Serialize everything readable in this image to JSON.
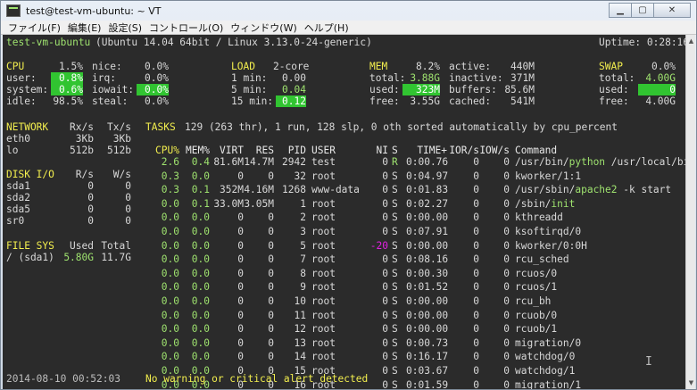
{
  "window": {
    "title": "test@test-vm-ubuntu: ~ VT"
  },
  "menu": [
    "ファイル(F)",
    "編集(E)",
    "設定(S)",
    "コントロール(O)",
    "ウィンドウ(W)",
    "ヘルプ(H)"
  ],
  "top": {
    "host": "test-vm-ubuntu",
    "os": "(Ubuntu 14.04 64bit / Linux 3.13.0-24-generic)",
    "uptime": "Uptime: 0:28:16"
  },
  "cpu": {
    "title": "CPU",
    "total": "1.5%",
    "user_l": "user:",
    "user": "0.8%",
    "system_l": "system:",
    "system": "0.6%",
    "idle_l": "idle:",
    "idle": "98.5%",
    "nice_l": "nice:",
    "nice": "0.0%",
    "irq_l": "irq:",
    "irq": "0.0%",
    "iowait_l": "iowait:",
    "iowait": "0.0%",
    "steal_l": "steal:",
    "steal": "0.0%"
  },
  "load": {
    "title": "LOAD",
    "cores": "2-core",
    "m1_l": "1 min:",
    "m1": "0.00",
    "m5_l": "5 min:",
    "m5": "0.04",
    "m15_l": "15 min:",
    "m15": "0.12"
  },
  "mem": {
    "title": "MEM",
    "pct": "8.2%",
    "total_l": "total:",
    "total": "3.88G",
    "used_l": "used:",
    "used": "323M",
    "free_l": "free:",
    "free": "3.55G",
    "active_l": "active:",
    "active": "440M",
    "inactive_l": "inactive:",
    "inactive": "371M",
    "buffers_l": "buffers:",
    "buffers": "85.6M",
    "cached_l": "cached:",
    "cached": "541M"
  },
  "swap": {
    "title": "SWAP",
    "pct": "0.0%",
    "total_l": "total:",
    "total": "4.00G",
    "used_l": "used:",
    "used": "0",
    "free_l": "free:",
    "free": "4.00G"
  },
  "network": {
    "title": "NETWORK",
    "rx": "Rx/s",
    "tx": "Tx/s",
    "rows": [
      [
        "eth0",
        "3Kb",
        "3Kb"
      ],
      [
        "lo",
        "512b",
        "512b"
      ]
    ]
  },
  "disk": {
    "title": "DISK I/O",
    "r": "R/s",
    "w": "W/s",
    "rows": [
      [
        "sda1",
        "0",
        "0"
      ],
      [
        "sda2",
        "0",
        "0"
      ],
      [
        "sda5",
        "0",
        "0"
      ],
      [
        "sr0",
        "0",
        "0"
      ]
    ]
  },
  "fs": {
    "title": "FILE SYS",
    "used": "Used",
    "total": "Total",
    "rows": [
      [
        "/ (sda1)",
        "5.80G",
        "11.7G"
      ]
    ]
  },
  "tasks": {
    "title": "TASKS",
    "summary": "129 (263 thr), 1 run, 128 slp, 0 oth sorted automatically by cpu_percent"
  },
  "columns": {
    "cpu": "CPU%",
    "mem": "MEM%",
    "virt": "VIRT",
    "res": "RES",
    "pid": "PID",
    "user": "USER",
    "ni": "NI",
    "s": "S",
    "time": "TIME+",
    "ior": "IOR/s",
    "iow": "IOW/s",
    "cmd": "Command"
  },
  "procs": [
    {
      "cpu": "2.6",
      "mem": "0.4",
      "virt": "81.6M",
      "res": "14.7M",
      "pid": "2942",
      "user": "test",
      "ni": "0",
      "s": "R",
      "time": "0:00.76",
      "ior": "0",
      "iow": "0",
      "cmd_a": "/usr/bin/",
      "cmd_b": "python",
      "cmd_c": " /usr/local/bin/"
    },
    {
      "cpu": "0.3",
      "mem": "0.0",
      "virt": "0",
      "res": "0",
      "pid": "32",
      "user": "root",
      "ni": "0",
      "s": "S",
      "time": "0:04.97",
      "ior": "0",
      "iow": "0",
      "cmd_a": "kworker/1:1",
      "cmd_b": "",
      "cmd_c": ""
    },
    {
      "cpu": "0.3",
      "mem": "0.1",
      "virt": "352M",
      "res": "4.16M",
      "pid": "1268",
      "user": "www-data",
      "ni": "0",
      "s": "S",
      "time": "0:01.83",
      "ior": "0",
      "iow": "0",
      "cmd_a": "/usr/sbin/",
      "cmd_b": "apache2",
      "cmd_c": " -k start"
    },
    {
      "cpu": "0.0",
      "mem": "0.1",
      "virt": "33.0M",
      "res": "3.05M",
      "pid": "1",
      "user": "root",
      "ni": "0",
      "s": "S",
      "time": "0:02.27",
      "ior": "0",
      "iow": "0",
      "cmd_a": "/sbin/",
      "cmd_b": "init",
      "cmd_c": ""
    },
    {
      "cpu": "0.0",
      "mem": "0.0",
      "virt": "0",
      "res": "0",
      "pid": "2",
      "user": "root",
      "ni": "0",
      "s": "S",
      "time": "0:00.00",
      "ior": "0",
      "iow": "0",
      "cmd_a": "kthreadd",
      "cmd_b": "",
      "cmd_c": ""
    },
    {
      "cpu": "0.0",
      "mem": "0.0",
      "virt": "0",
      "res": "0",
      "pid": "3",
      "user": "root",
      "ni": "0",
      "s": "S",
      "time": "0:07.91",
      "ior": "0",
      "iow": "0",
      "cmd_a": "ksoftirqd/0",
      "cmd_b": "",
      "cmd_c": ""
    },
    {
      "cpu": "0.0",
      "mem": "0.0",
      "virt": "0",
      "res": "0",
      "pid": "5",
      "user": "root",
      "ni": "-20",
      "s": "S",
      "time": "0:00.00",
      "ior": "0",
      "iow": "0",
      "cmd_a": "kworker/0:0H",
      "cmd_b": "",
      "cmd_c": ""
    },
    {
      "cpu": "0.0",
      "mem": "0.0",
      "virt": "0",
      "res": "0",
      "pid": "7",
      "user": "root",
      "ni": "0",
      "s": "S",
      "time": "0:08.16",
      "ior": "0",
      "iow": "0",
      "cmd_a": "rcu_sched",
      "cmd_b": "",
      "cmd_c": ""
    },
    {
      "cpu": "0.0",
      "mem": "0.0",
      "virt": "0",
      "res": "0",
      "pid": "8",
      "user": "root",
      "ni": "0",
      "s": "S",
      "time": "0:00.30",
      "ior": "0",
      "iow": "0",
      "cmd_a": "rcuos/0",
      "cmd_b": "",
      "cmd_c": ""
    },
    {
      "cpu": "0.0",
      "mem": "0.0",
      "virt": "0",
      "res": "0",
      "pid": "9",
      "user": "root",
      "ni": "0",
      "s": "S",
      "time": "0:01.52",
      "ior": "0",
      "iow": "0",
      "cmd_a": "rcuos/1",
      "cmd_b": "",
      "cmd_c": ""
    },
    {
      "cpu": "0.0",
      "mem": "0.0",
      "virt": "0",
      "res": "0",
      "pid": "10",
      "user": "root",
      "ni": "0",
      "s": "S",
      "time": "0:00.00",
      "ior": "0",
      "iow": "0",
      "cmd_a": "rcu_bh",
      "cmd_b": "",
      "cmd_c": ""
    },
    {
      "cpu": "0.0",
      "mem": "0.0",
      "virt": "0",
      "res": "0",
      "pid": "11",
      "user": "root",
      "ni": "0",
      "s": "S",
      "time": "0:00.00",
      "ior": "0",
      "iow": "0",
      "cmd_a": "rcuob/0",
      "cmd_b": "",
      "cmd_c": ""
    },
    {
      "cpu": "0.0",
      "mem": "0.0",
      "virt": "0",
      "res": "0",
      "pid": "12",
      "user": "root",
      "ni": "0",
      "s": "S",
      "time": "0:00.00",
      "ior": "0",
      "iow": "0",
      "cmd_a": "rcuob/1",
      "cmd_b": "",
      "cmd_c": ""
    },
    {
      "cpu": "0.0",
      "mem": "0.0",
      "virt": "0",
      "res": "0",
      "pid": "13",
      "user": "root",
      "ni": "0",
      "s": "S",
      "time": "0:00.73",
      "ior": "0",
      "iow": "0",
      "cmd_a": "migration/0",
      "cmd_b": "",
      "cmd_c": ""
    },
    {
      "cpu": "0.0",
      "mem": "0.0",
      "virt": "0",
      "res": "0",
      "pid": "14",
      "user": "root",
      "ni": "0",
      "s": "S",
      "time": "0:16.17",
      "ior": "0",
      "iow": "0",
      "cmd_a": "watchdog/0",
      "cmd_b": "",
      "cmd_c": ""
    },
    {
      "cpu": "0.0",
      "mem": "0.0",
      "virt": "0",
      "res": "0",
      "pid": "15",
      "user": "root",
      "ni": "0",
      "s": "S",
      "time": "0:03.67",
      "ior": "0",
      "iow": "0",
      "cmd_a": "watchdog/1",
      "cmd_b": "",
      "cmd_c": ""
    },
    {
      "cpu": "0.0",
      "mem": "0.0",
      "virt": "0",
      "res": "0",
      "pid": "16",
      "user": "root",
      "ni": "0",
      "s": "S",
      "time": "0:01.59",
      "ior": "0",
      "iow": "0",
      "cmd_a": "migration/1",
      "cmd_b": "",
      "cmd_c": ""
    }
  ],
  "footer": {
    "datetime": "2014-08-10 00:52:03",
    "alert": "No warning or critical alert detected"
  }
}
